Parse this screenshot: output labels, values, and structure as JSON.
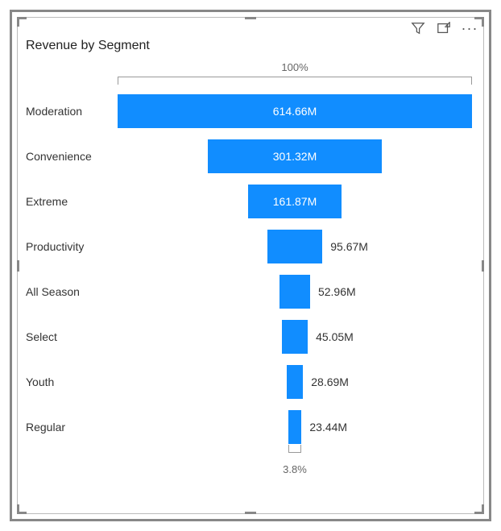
{
  "title": "Revenue by Segment",
  "top_percent": "100%",
  "bottom_percent": "3.8%",
  "chart_data": {
    "type": "bar",
    "orientation": "funnel",
    "title": "Revenue by Segment",
    "unit": "M",
    "categories": [
      "Moderation",
      "Convenience",
      "Extreme",
      "Productivity",
      "All Season",
      "Select",
      "Youth",
      "Regular"
    ],
    "values": [
      614.66,
      301.32,
      161.87,
      95.67,
      52.96,
      45.05,
      28.69,
      23.44
    ],
    "value_labels": [
      "614.66M",
      "301.32M",
      "161.87M",
      "95.67M",
      "52.96M",
      "45.05M",
      "28.69M",
      "23.44M"
    ],
    "first_pct": "100%",
    "last_pct": "3.8%",
    "bar_color": "#118dff"
  }
}
